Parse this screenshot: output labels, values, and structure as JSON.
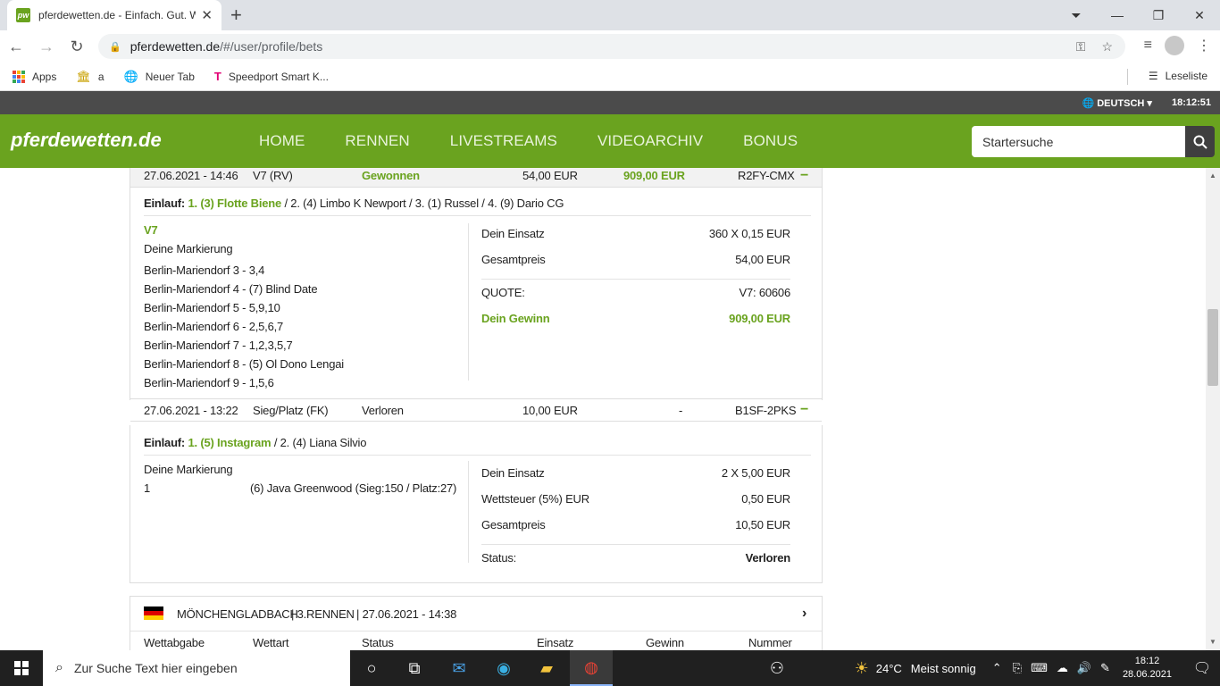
{
  "browser": {
    "tab_title": "pferdewetten.de - Einfach. Gut. W",
    "tab_favicon_text": "pw",
    "url_host": "pferdewetten.de",
    "url_path": "/#/user/profile/bets",
    "bookmarks": [
      {
        "label": "Apps",
        "icon": "apps-grid-icon"
      },
      {
        "label": "a",
        "icon": "bank-icon"
      },
      {
        "label": "Neuer Tab",
        "icon": "globe-icon"
      },
      {
        "label": "Speedport Smart K...",
        "icon": "telekom-icon"
      }
    ],
    "reading_list": "Leseliste"
  },
  "site": {
    "language": "DEUTSCH",
    "time": "18:12:51",
    "logo": "pferdewetten.de",
    "menu": [
      "HOME",
      "RENNEN",
      "LIVESTREAMS",
      "VIDEOARCHIV",
      "BONUS"
    ],
    "search_placeholder": "Startersuche",
    "accent": "#6aa31f"
  },
  "bets": [
    {
      "date": "27.06.2021 - 14:46",
      "type": "V7 (RV)",
      "status": "Gewonnen",
      "stake": "54,00 EUR",
      "win": "909,00 EUR",
      "number": "R2FY-CMX",
      "einlauf_label": "Einlauf:",
      "einlauf_first": "1. (3) Flotte Biene",
      "einlauf_rest": "/ 2. (4) Limbo K Newport  / 3. (1) Russel  / 4. (9) Dario CG",
      "bet_name": "V7",
      "marking_label": "Deine Markierung",
      "markings": [
        "Berlin-Mariendorf 3 - 3,4",
        "Berlin-Mariendorf 4 - (7) Blind Date",
        "Berlin-Mariendorf 5 - 5,9,10",
        "Berlin-Mariendorf 6 - 2,5,6,7",
        "Berlin-Mariendorf 7 - 1,2,3,5,7",
        "Berlin-Mariendorf 8 - (5) Ol Dono Lengai",
        "Berlin-Mariendorf 9 - 1,5,6"
      ],
      "summary": [
        {
          "label": "Dein Einsatz",
          "value": "360 X 0,15 EUR"
        },
        {
          "label": "Gesamtpreis",
          "value": "54,00 EUR"
        },
        {
          "label": "QUOTE:",
          "value": "V7: 60606"
        },
        {
          "label": "Dein Gewinn",
          "value": "909,00 EUR"
        }
      ]
    },
    {
      "date": "27.06.2021 - 13:22",
      "type": "Sieg/Platz (FK)",
      "status": "Verloren",
      "stake": "10,00 EUR",
      "win": "-",
      "number": "B1SF-2PKS",
      "einlauf_label": "Einlauf:",
      "einlauf_first": "1. (5) Instagram",
      "einlauf_rest": "/ 2. (4) Liana Silvio",
      "marking_label": "Deine Markierung",
      "marking_num": "1",
      "marking_horse": "(6) Java Greenwood (Sieg:150 / Platz:27)",
      "summary": [
        {
          "label": "Dein Einsatz",
          "value": "2 X 5,00 EUR"
        },
        {
          "label": "Wettsteuer (5%) EUR",
          "value": "0,50 EUR"
        },
        {
          "label": "Gesamtpreis",
          "value": "10,50 EUR"
        },
        {
          "label": "Status:",
          "value": "Verloren"
        }
      ]
    }
  ],
  "race": {
    "title": "MÖNCHENGLADBACH",
    "race_no": "| 3.RENNEN",
    "datetime": "| 27.06.2021 - 14:38",
    "columns": [
      "Wettabgabe",
      "Wettart",
      "Status",
      "Einsatz",
      "Gewinn",
      "Nummer"
    ]
  },
  "taskbar": {
    "search_placeholder": "Zur Suche Text hier eingeben",
    "weather_temp": "24°C",
    "weather_text": "Meist sonnig",
    "clock_time": "18:12",
    "clock_date": "28.06.2021"
  }
}
